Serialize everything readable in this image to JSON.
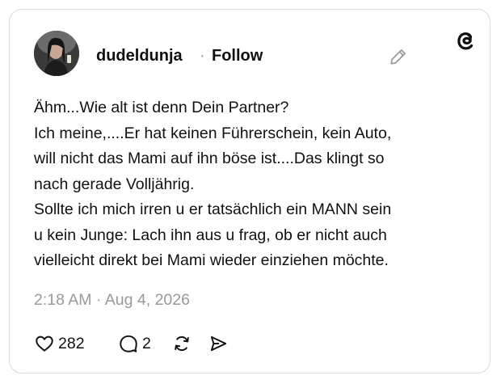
{
  "post": {
    "username": "dudeldunja",
    "separator": "·",
    "follow_label": "Follow",
    "text_lines": [
      "Ähm...Wie alt ist denn Dein Partner?",
      "Ich meine,....Er hat keinen Führerschein, kein Auto,",
      "will nicht das Mami auf ihn böse ist....Das klingt so",
      "nach gerade Volljährig.",
      "Sollte ich mich irren u er tatsächlich ein MANN sein",
      "u kein Junge: Lach ihn aus u frag, ob er nicht auch",
      "vielleicht direkt bei Mami wieder einziehen möchte."
    ],
    "timestamp": "2:18 AM · Aug 4, 2026"
  },
  "actions": {
    "likes": "282",
    "replies": "2"
  },
  "icons": [
    "avatar",
    "edit-icon",
    "threads-logo-icon",
    "heart-icon",
    "comment-icon",
    "repost-icon",
    "share-icon"
  ],
  "colors": {
    "text": "#101010",
    "muted": "#999999",
    "border": "#d9d9d9"
  }
}
